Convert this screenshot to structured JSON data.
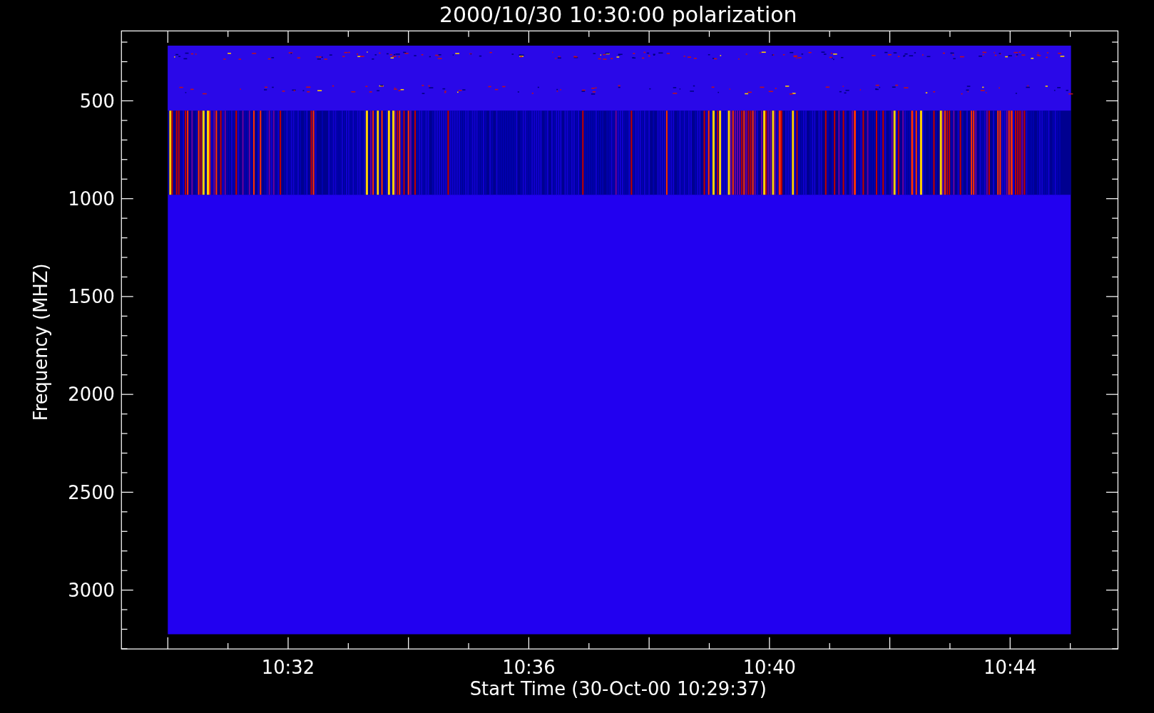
{
  "title": "2000/10/30 10:30:00 polarization",
  "ylabel": "Frequency (MHZ)",
  "xlabel": "Start Time (30-Oct-00 10:29:37)",
  "yticks": [
    "500",
    "1000",
    "1500",
    "2000",
    "2500",
    "3000"
  ],
  "xticks": [
    "10:32",
    "10:36",
    "10:40",
    "10:44"
  ]
}
